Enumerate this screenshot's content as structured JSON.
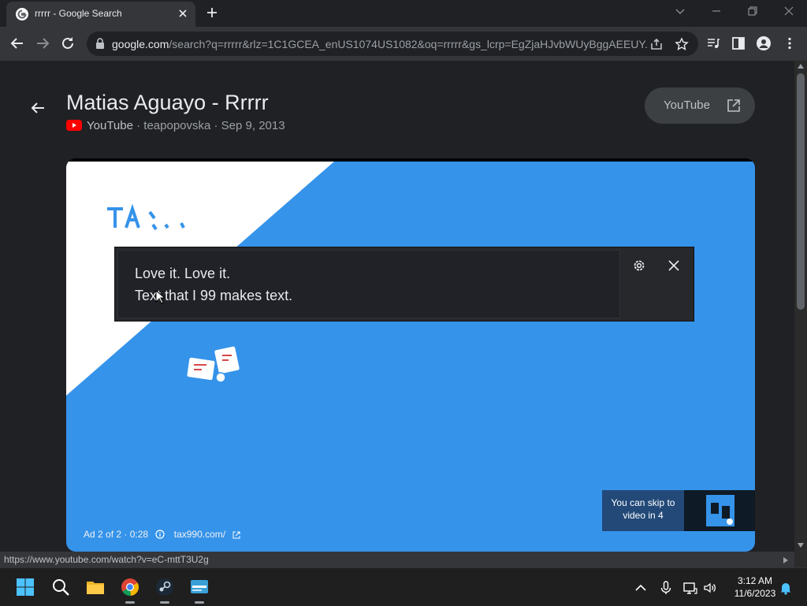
{
  "browser": {
    "tab_title": "rrrrr - Google Search",
    "url_host": "google.com",
    "url_rest": "/search?q=rrrrr&rlz=1C1GCEA_enUS1074US1082&oq=rrrrr&gs_lcrp=EgZjaHJvbWUyBggAEEUY..."
  },
  "video": {
    "title": "Matias Aguayo - Rrrrr",
    "source": "YouTube",
    "channel_date": "· teapopovska · Sep 9, 2013",
    "open_button_label": "YouTube"
  },
  "player": {
    "ad_label": "Ad 2 of 2 · 0:28",
    "ad_domain": "tax990.com/",
    "skip_text": "You can skip to video in 4"
  },
  "captions": {
    "line1": "Love it. Love it.",
    "line2": "Text that I 99 makes text."
  },
  "status_bar": {
    "url": "https://www.youtube.com/watch?v=eC-mttT3U2g"
  },
  "taskbar": {
    "time": "3:12 AM",
    "date": "11/6/2023"
  },
  "colors": {
    "video_blue": "#3593ea",
    "youtube_red": "#ff0000",
    "page_bg": "#202124"
  }
}
